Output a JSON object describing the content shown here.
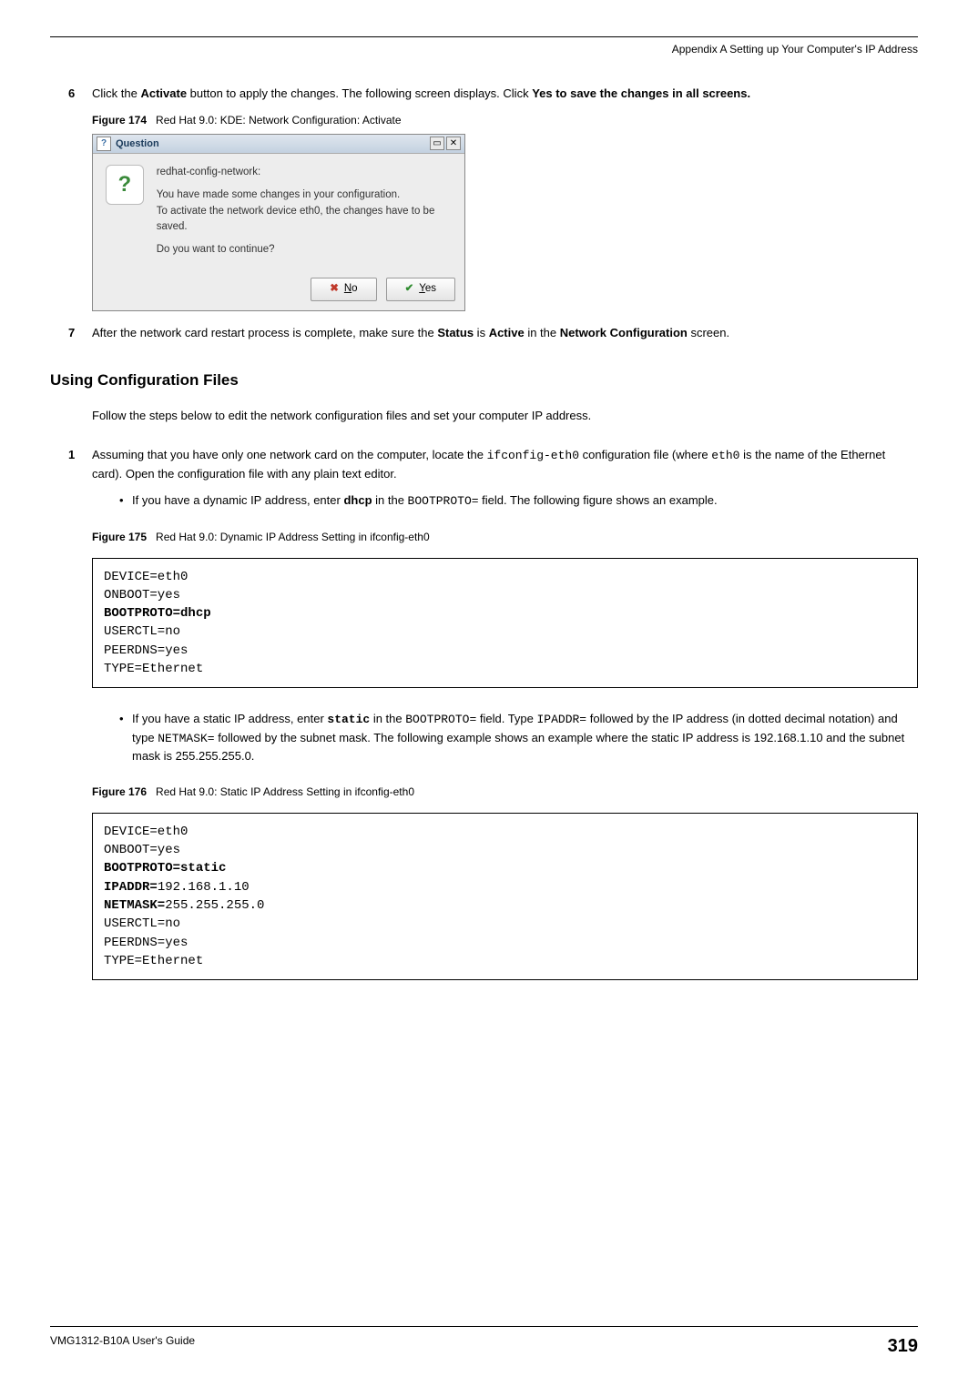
{
  "header": {
    "appendix": "Appendix A Setting up Your Computer's IP Address"
  },
  "step6": {
    "num": "6",
    "text_pre": "Click the ",
    "activate": "Activate",
    "text_mid": " button to apply the changes. The following screen displays. Click ",
    "yes_bold": "Yes to save the changes in all screens."
  },
  "fig174": {
    "label": "Figure 174",
    "caption": "Red Hat 9.0: KDE: Network Configuration: Activate"
  },
  "dialog": {
    "title": "Question",
    "line1": "redhat-config-network:",
    "line2": "You have made some changes in your configuration.",
    "line3": "To activate the network device eth0, the changes have to be saved.",
    "line4": "Do you want to continue?",
    "no_label": "No",
    "yes_label": "Yes"
  },
  "step7": {
    "num": "7",
    "pre": "After the network card restart process is complete, make sure the ",
    "status": "Status",
    "mid": " is ",
    "active": "Active",
    "mid2": " in the ",
    "netcfg": "Network Configuration",
    "post": " screen."
  },
  "section": {
    "heading": "Using Configuration Files",
    "intro": "Follow the steps below to edit the network configuration files and set your computer IP address."
  },
  "step1": {
    "num": "1",
    "pre": "Assuming that you have only one network card on the computer, locate the ",
    "code1": "ifconfig-eth0",
    "mid": " configuration file (where ",
    "code2": "eth0",
    "post": " is the name of the Ethernet card). Open the configuration file with any plain text editor."
  },
  "bullet_dhcp": {
    "pre": "If you have a dynamic IP address, enter ",
    "dhcp": "dhcp",
    "mid": " in the ",
    "field": "BOOTPROTO=",
    "post": " field.  The following figure shows an example."
  },
  "fig175": {
    "label": "Figure 175",
    "caption": "Red Hat 9.0: Dynamic IP Address Setting in ifconfig-eth0"
  },
  "code_dhcp": {
    "l1": "DEVICE=eth0",
    "l2": "ONBOOT=yes",
    "l3": "BOOTPROTO=dhcp",
    "l4": "USERCTL=no",
    "l5": "PEERDNS=yes",
    "l6": "TYPE=Ethernet"
  },
  "bullet_static": {
    "pre": "If you have a static IP address, enter ",
    "static": "static",
    "mid": " in the ",
    "field": "BOOTPROTO=",
    "mid2": " field. Type ",
    "ipaddr": "IPADDR=",
    "mid3": " followed by the IP address (in dotted decimal notation) and type ",
    "netmask": "NETMASK=",
    "post": " followed by the subnet mask. The following example shows an example where the static IP address is 192.168.1.10 and the subnet mask is 255.255.255.0."
  },
  "fig176": {
    "label": "Figure 176",
    "caption": "Red Hat 9.0: Static IP Address Setting in ifconfig-eth0"
  },
  "code_static": {
    "l1": "DEVICE=eth0",
    "l2": "ONBOOT=yes",
    "l3b": "BOOTPROTO=",
    "l3v": "static",
    "l4b": "IPADDR=",
    "l4v": "192.168.1.10",
    "l5b": "NETMASK=",
    "l5v": "255.255.255.0",
    "l6": "USERCTL=no",
    "l7": "PEERDNS=yes",
    "l8": "TYPE=Ethernet"
  },
  "footer": {
    "guide": "VMG1312-B10A User's Guide",
    "page": "319"
  }
}
